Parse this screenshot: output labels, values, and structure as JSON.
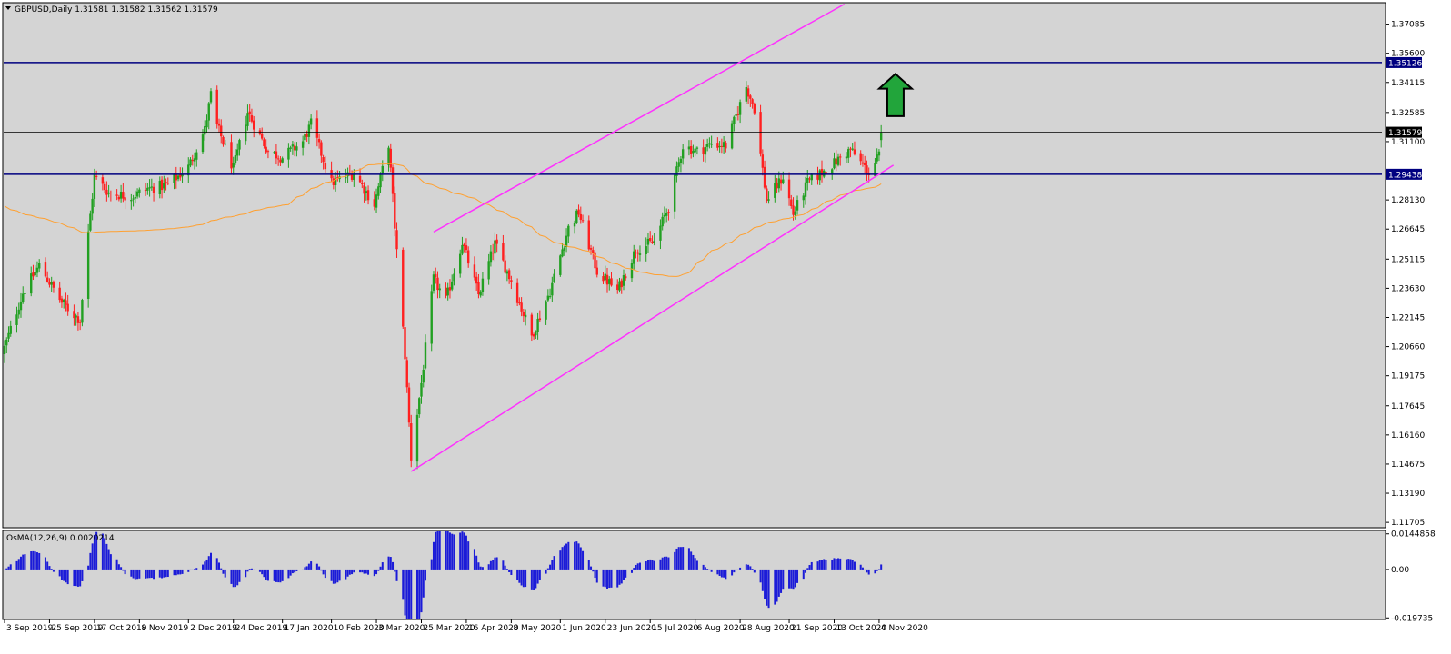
{
  "window": {
    "symbol": "GBPUSD",
    "timeframe": "Daily",
    "ohlc_readout": "1.31581 1.31582 1.31562 1.31579",
    "title_text": "GBPUSD,Daily  1.31581 1.31582 1.31562 1.31579"
  },
  "colors": {
    "background": "#d4d4d4",
    "bull": "#22a022",
    "bear": "#ff2020",
    "ma": "#ffa030",
    "channel": "#ff30ff",
    "hline": "#000080",
    "current_line": "#000000",
    "osma": "#1b1bd8",
    "arrow_fill": "#22a53b"
  },
  "price_axis": {
    "ticks": [
      "1.37085",
      "1.35600",
      "1.34115",
      "1.32585",
      "1.31100",
      "1.28130",
      "1.26645",
      "1.25115",
      "1.23630",
      "1.22145",
      "1.20660",
      "1.19175",
      "1.17645",
      "1.16160",
      "1.14675",
      "1.13190",
      "1.11705"
    ],
    "ylim": [
      1.1148,
      1.3813
    ],
    "badges": [
      {
        "name": "resistance-level",
        "value": "1.35126",
        "style": "blue"
      },
      {
        "name": "current-price",
        "value": "1.31579",
        "style": "dark"
      },
      {
        "name": "support-level",
        "value": "1.29438",
        "style": "blue"
      }
    ]
  },
  "time_axis": {
    "labels": [
      "3 Sep 2019",
      "25 Sep 2019",
      "17 Oct 2019",
      "8 Nov 2019",
      "2 Dec 2019",
      "24 Dec 2019",
      "17 Jan 2020",
      "10 Feb 2020",
      "3 Mar 2020",
      "25 Mar 2020",
      "16 Apr 2020",
      "8 May 2020",
      "1 Jun 2020",
      "23 Jun 2020",
      "15 Jul 2020",
      "6 Aug 2020",
      "28 Aug 2020",
      "21 Sep 2020",
      "13 Oct 2020",
      "4 Nov 2020"
    ]
  },
  "osma": {
    "label": "OsMA(12,26,9) 0.0020214",
    "axis_ticks": [
      "0.0144858",
      "0.00",
      "-0.019735"
    ],
    "ylim": [
      -0.02,
      0.0155
    ]
  },
  "chart_data": {
    "type": "candlestick",
    "symbol": "GBPUSD",
    "timeframe": "Daily",
    "x_range": [
      "3 Sep 2019",
      "5 Nov 2020"
    ],
    "ylim": [
      1.1148,
      1.3813
    ],
    "close_keyframes": [
      [
        "3 Sep 2019",
        1.206
      ],
      [
        "12 Sep 2019",
        1.234
      ],
      [
        "20 Sep 2019",
        1.248
      ],
      [
        "1 Oct 2019",
        1.229
      ],
      [
        "10 Oct 2019",
        1.22
      ],
      [
        "14 Oct 2019",
        1.264
      ],
      [
        "17 Oct 2019",
        1.293
      ],
      [
        "24 Oct 2019",
        1.285
      ],
      [
        "4 Nov 2019",
        1.283
      ],
      [
        "12 Nov 2019",
        1.287
      ],
      [
        "22 Nov 2019",
        1.289
      ],
      [
        "2 Dec 2019",
        1.298
      ],
      [
        "10 Dec 2019",
        1.317
      ],
      [
        "13 Dec 2019",
        1.335
      ],
      [
        "16 Dec 2019",
        1.319
      ],
      [
        "24 Dec 2019",
        1.297
      ],
      [
        "31 Dec 2019",
        1.326
      ],
      [
        "10 Jan 2020",
        1.306
      ],
      [
        "17 Jan 2020",
        1.303
      ],
      [
        "27 Jan 2020",
        1.311
      ],
      [
        "31 Jan 2020",
        1.32
      ],
      [
        "10 Feb 2020",
        1.29
      ],
      [
        "21 Feb 2020",
        1.295
      ],
      [
        "2 Mar 2020",
        1.279
      ],
      [
        "9 Mar 2020",
        1.31
      ],
      [
        "12 Mar 2020",
        1.268
      ],
      [
        "17 Mar 2020",
        1.202
      ],
      [
        "20 Mar 2020",
        1.15
      ],
      [
        "25 Mar 2020",
        1.188
      ],
      [
        "31 Mar 2020",
        1.241
      ],
      [
        "6 Apr 2020",
        1.23
      ],
      [
        "14 Apr 2020",
        1.26
      ],
      [
        "22 Apr 2020",
        1.233
      ],
      [
        "30 Apr 2020",
        1.259
      ],
      [
        "8 May 2020",
        1.24
      ],
      [
        "18 May 2020",
        1.212
      ],
      [
        "27 May 2020",
        1.235
      ],
      [
        "5 Jun 2020",
        1.267
      ],
      [
        "10 Jun 2020",
        1.275
      ],
      [
        "19 Jun 2020",
        1.245
      ],
      [
        "29 Jun 2020",
        1.235
      ],
      [
        "8 Jul 2020",
        1.256
      ],
      [
        "17 Jul 2020",
        1.26
      ],
      [
        "24 Jul 2020",
        1.278
      ],
      [
        "31 Jul 2020",
        1.309
      ],
      [
        "7 Aug 2020",
        1.306
      ],
      [
        "14 Aug 2020",
        1.31
      ],
      [
        "21 Aug 2020",
        1.309
      ],
      [
        "31 Aug 2020",
        1.339
      ],
      [
        "4 Sep 2020",
        1.328
      ],
      [
        "10 Sep 2020",
        1.281
      ],
      [
        "18 Sep 2020",
        1.293
      ],
      [
        "23 Sep 2020",
        1.274
      ],
      [
        "30 Sep 2020",
        1.29
      ],
      [
        "8 Oct 2020",
        1.296
      ],
      [
        "13 Oct 2020",
        1.3
      ],
      [
        "21 Oct 2020",
        1.307
      ],
      [
        "30 Oct 2020",
        1.295
      ],
      [
        "4 Nov 2020",
        1.304
      ],
      [
        "5 Nov 2020",
        1.3158
      ]
    ],
    "last_bar": {
      "open": 1.31581,
      "high": 1.31582,
      "low": 1.31562,
      "close": 1.31579
    },
    "overlays": {
      "horizontal_lines": [
        1.35126,
        1.29438,
        1.31579
      ],
      "moving_average": "orange long-period moving average, ~1.274 to ~1.284",
      "channel": "ascending parallel channel (magenta), lower line from 1.1430 (Mar 2020) to 1.2990 (Nov 2020), upper line from 1.2720 (Apr 2020) to 1.3815 (Oct 2020)",
      "annotation": "green up arrow near 1.3350 (early Nov 2020)"
    },
    "indicator": {
      "name": "OsMA(12,26,9)",
      "last_value": 0.0020214,
      "range": [
        -0.019735,
        0.0144858
      ]
    }
  }
}
